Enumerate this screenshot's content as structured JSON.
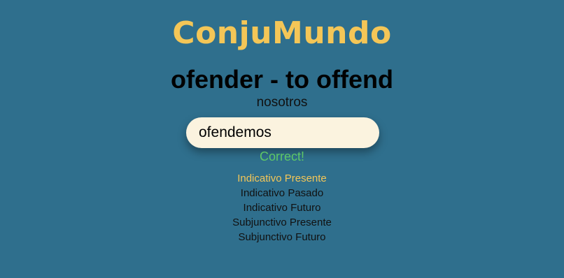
{
  "app": {
    "logo": "ConjuMundo"
  },
  "verb": {
    "title": "ofender - to offend",
    "pronoun": "nosotros"
  },
  "answer": {
    "value": "ofendemos",
    "feedback": "Correct!"
  },
  "tenses": {
    "items": [
      "Indicativo Presente",
      "Indicativo Pasado",
      "Indicativo Futuro",
      "Subjunctivo Presente",
      "Subjunctivo Futuro"
    ],
    "selected": "Indicativo Presente"
  },
  "colors": {
    "background": "#2f6f8d",
    "accent": "#f4c657",
    "correct": "#5ec867",
    "input_bg": "#fbf3df"
  }
}
